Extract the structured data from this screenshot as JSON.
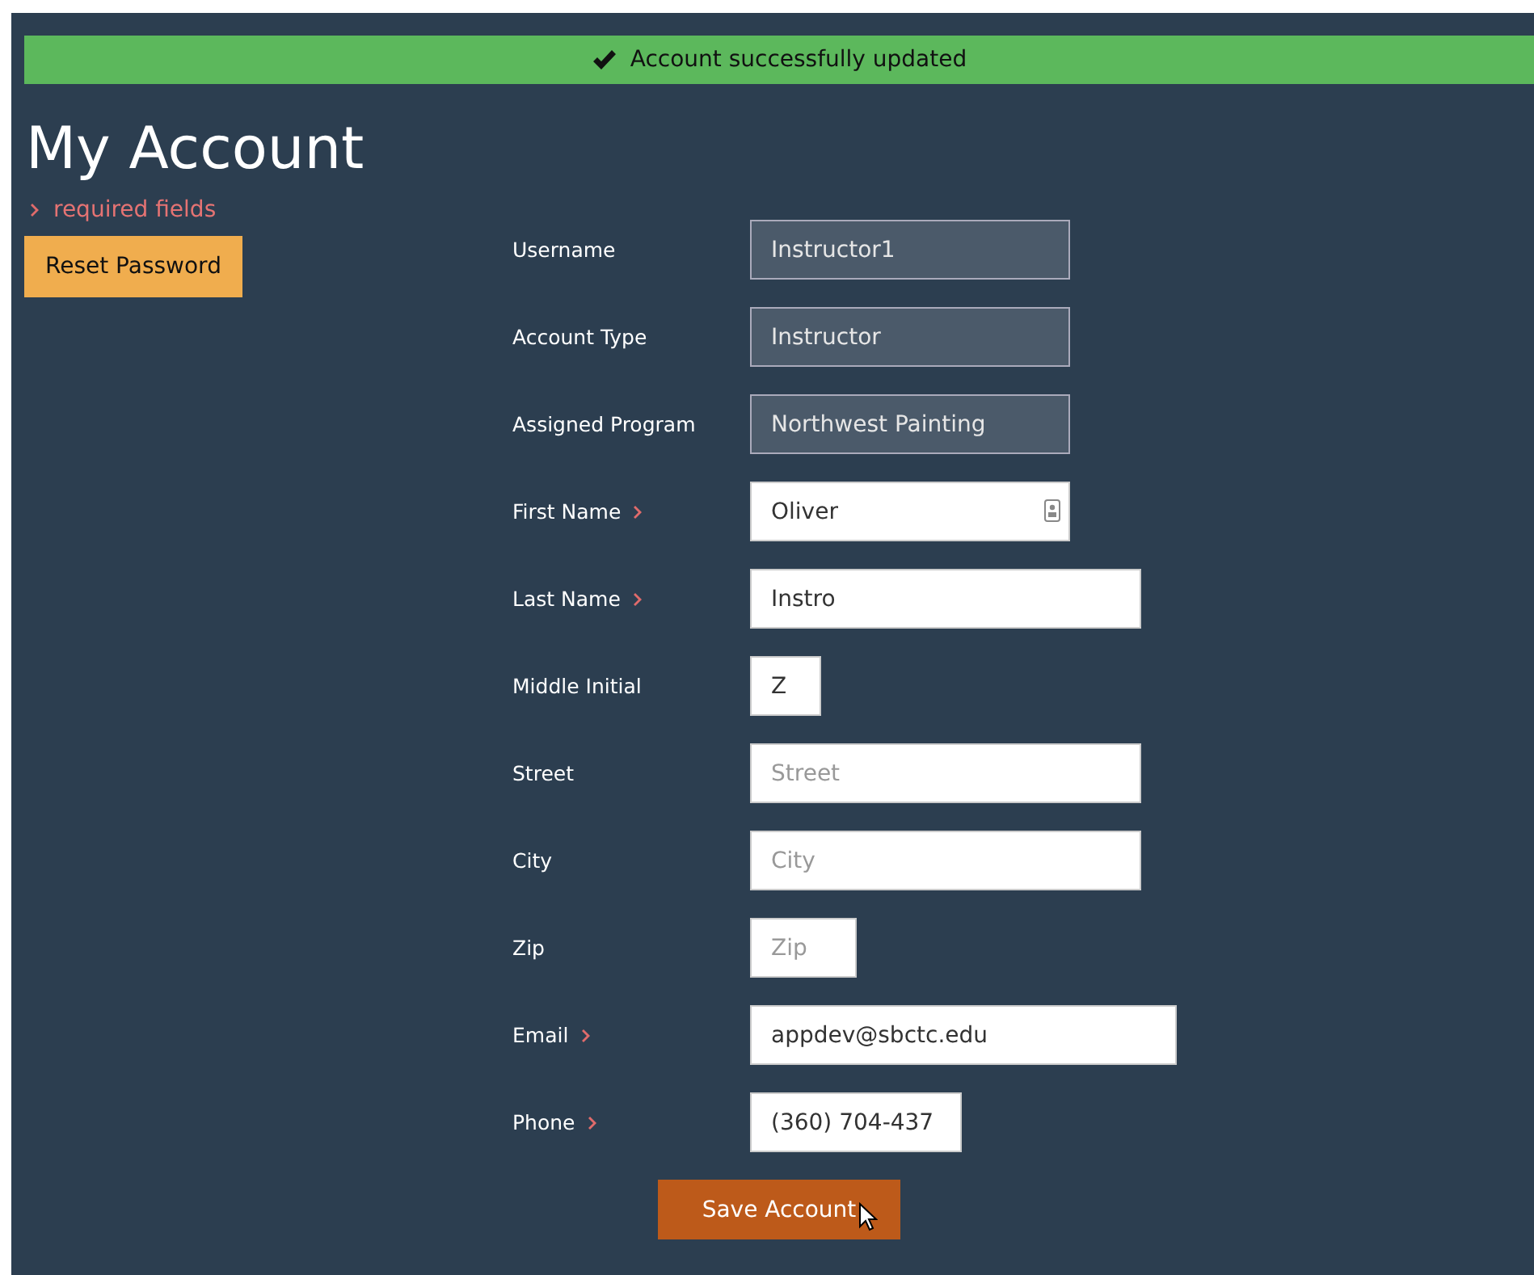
{
  "banner": {
    "message": "Account successfully updated"
  },
  "title": "My Account",
  "required_note": "required fields",
  "reset_button": "Reset Password",
  "fields": [
    {
      "label": "Username",
      "value": "Instructor1",
      "required": false,
      "disabled": true
    },
    {
      "label": "Account Type",
      "value": "Instructor",
      "required": false,
      "disabled": true
    },
    {
      "label": "Assigned Program",
      "value": "Northwest Painting",
      "required": false,
      "disabled": true
    },
    {
      "label": "First Name",
      "value": "Oliver",
      "required": true,
      "disabled": false,
      "autofill": true
    },
    {
      "label": "Last Name",
      "value": "Instro",
      "required": true,
      "disabled": false
    },
    {
      "label": "Middle Initial",
      "value": "Z",
      "required": false,
      "disabled": false
    },
    {
      "label": "Street",
      "placeholder": "Street",
      "required": false,
      "disabled": false
    },
    {
      "label": "City",
      "placeholder": "City",
      "required": false,
      "disabled": false
    },
    {
      "label": "Zip",
      "placeholder": "Zip",
      "required": false,
      "disabled": false
    },
    {
      "label": "Email",
      "value": "appdev@sbctc.edu",
      "required": true,
      "disabled": false
    },
    {
      "label": "Phone",
      "value": "(360) 704-437",
      "required": true,
      "disabled": false
    }
  ],
  "save_button": "Save Account"
}
